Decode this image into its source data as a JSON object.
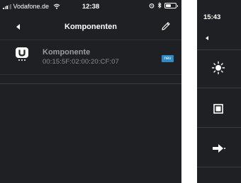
{
  "status_bar": {
    "carrier": "Vodafone.de",
    "time": "12:38",
    "icons": [
      "signal-icon",
      "wifi-icon",
      "alarm-icon",
      "bluetooth-icon",
      "battery-icon"
    ]
  },
  "nav": {
    "title": "Komponenten",
    "back_icon": "back-chevron-icon",
    "edit_icon": "pencil-icon"
  },
  "components": [
    {
      "name": "Komponente",
      "mac": "00:15:5F:02:00:20:CF:07",
      "badge": "neu",
      "icon": "u-device-icon"
    }
  ],
  "right_screen": {
    "time": "15:43",
    "back_icon": "back-chevron-icon",
    "rows": [
      {
        "icon": "light-icon"
      },
      {
        "icon": "stop-icon"
      },
      {
        "icon": "arrow-right-icon"
      }
    ]
  },
  "colors": {
    "background": "#1f2023",
    "badge": "#2e8bc4",
    "text_primary": "#ffffff",
    "text_secondary": "#9a9ca0"
  }
}
